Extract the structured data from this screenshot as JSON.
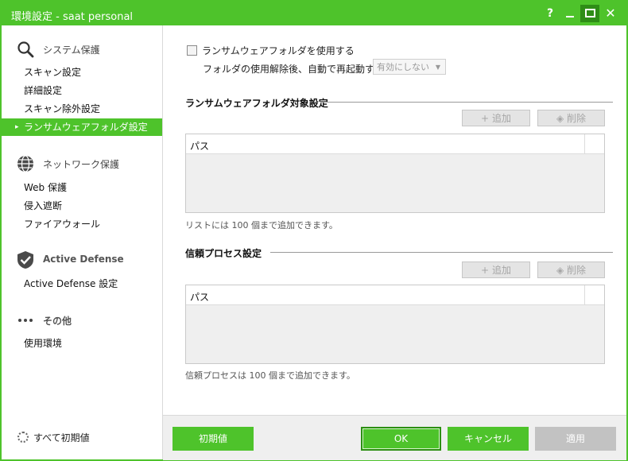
{
  "window": {
    "title": "環境設定 - saat personal"
  },
  "titlebar_buttons": {
    "help": "?"
  },
  "sidebar": {
    "system_protection": {
      "label": "システム保護",
      "items": [
        {
          "label": "スキャン設定"
        },
        {
          "label": "詳細設定"
        },
        {
          "label": "スキャン除外設定"
        },
        {
          "label": "ランサムウェアフォルダ設定",
          "selected": true
        }
      ]
    },
    "network_protection": {
      "label": "ネットワーク保護",
      "items": [
        {
          "label": "Web 保護"
        },
        {
          "label": "侵入遮断"
        },
        {
          "label": "ファイアウォール"
        }
      ]
    },
    "active_defense": {
      "label": "Active Defense",
      "items": [
        {
          "label": "Active Defense 設定"
        }
      ]
    },
    "other": {
      "label": "その他",
      "items": [
        {
          "label": "使用環境"
        }
      ]
    },
    "reset_all": "すべて初期値"
  },
  "main": {
    "use_ransomware_folder": {
      "label": "ランサムウェアフォルダを使用する",
      "checked": false
    },
    "auto_restart": {
      "label": "フォルダの使用解除後、自動で再起動する",
      "select_value": "有効にしない"
    },
    "target_section": {
      "title": "ランサムウェアフォルダ対象設定",
      "add_label": "追加",
      "delete_label": "削除",
      "column_path": "パス",
      "note": "リストには 100 個まで追加できます。"
    },
    "trusted_section": {
      "title": "信頼プロセス設定",
      "add_label": "追加",
      "delete_label": "削除",
      "column_path": "パス",
      "note": "信頼プロセスは 100 個まで追加できます。"
    }
  },
  "footer": {
    "defaults_label": "初期値",
    "ok_label": "OK",
    "cancel_label": "キャンセル",
    "apply_label": "適用"
  },
  "colors": {
    "accent": "#4ec32b",
    "accent_dark": "#2e8d17",
    "disabled": "#c2c2c2"
  }
}
